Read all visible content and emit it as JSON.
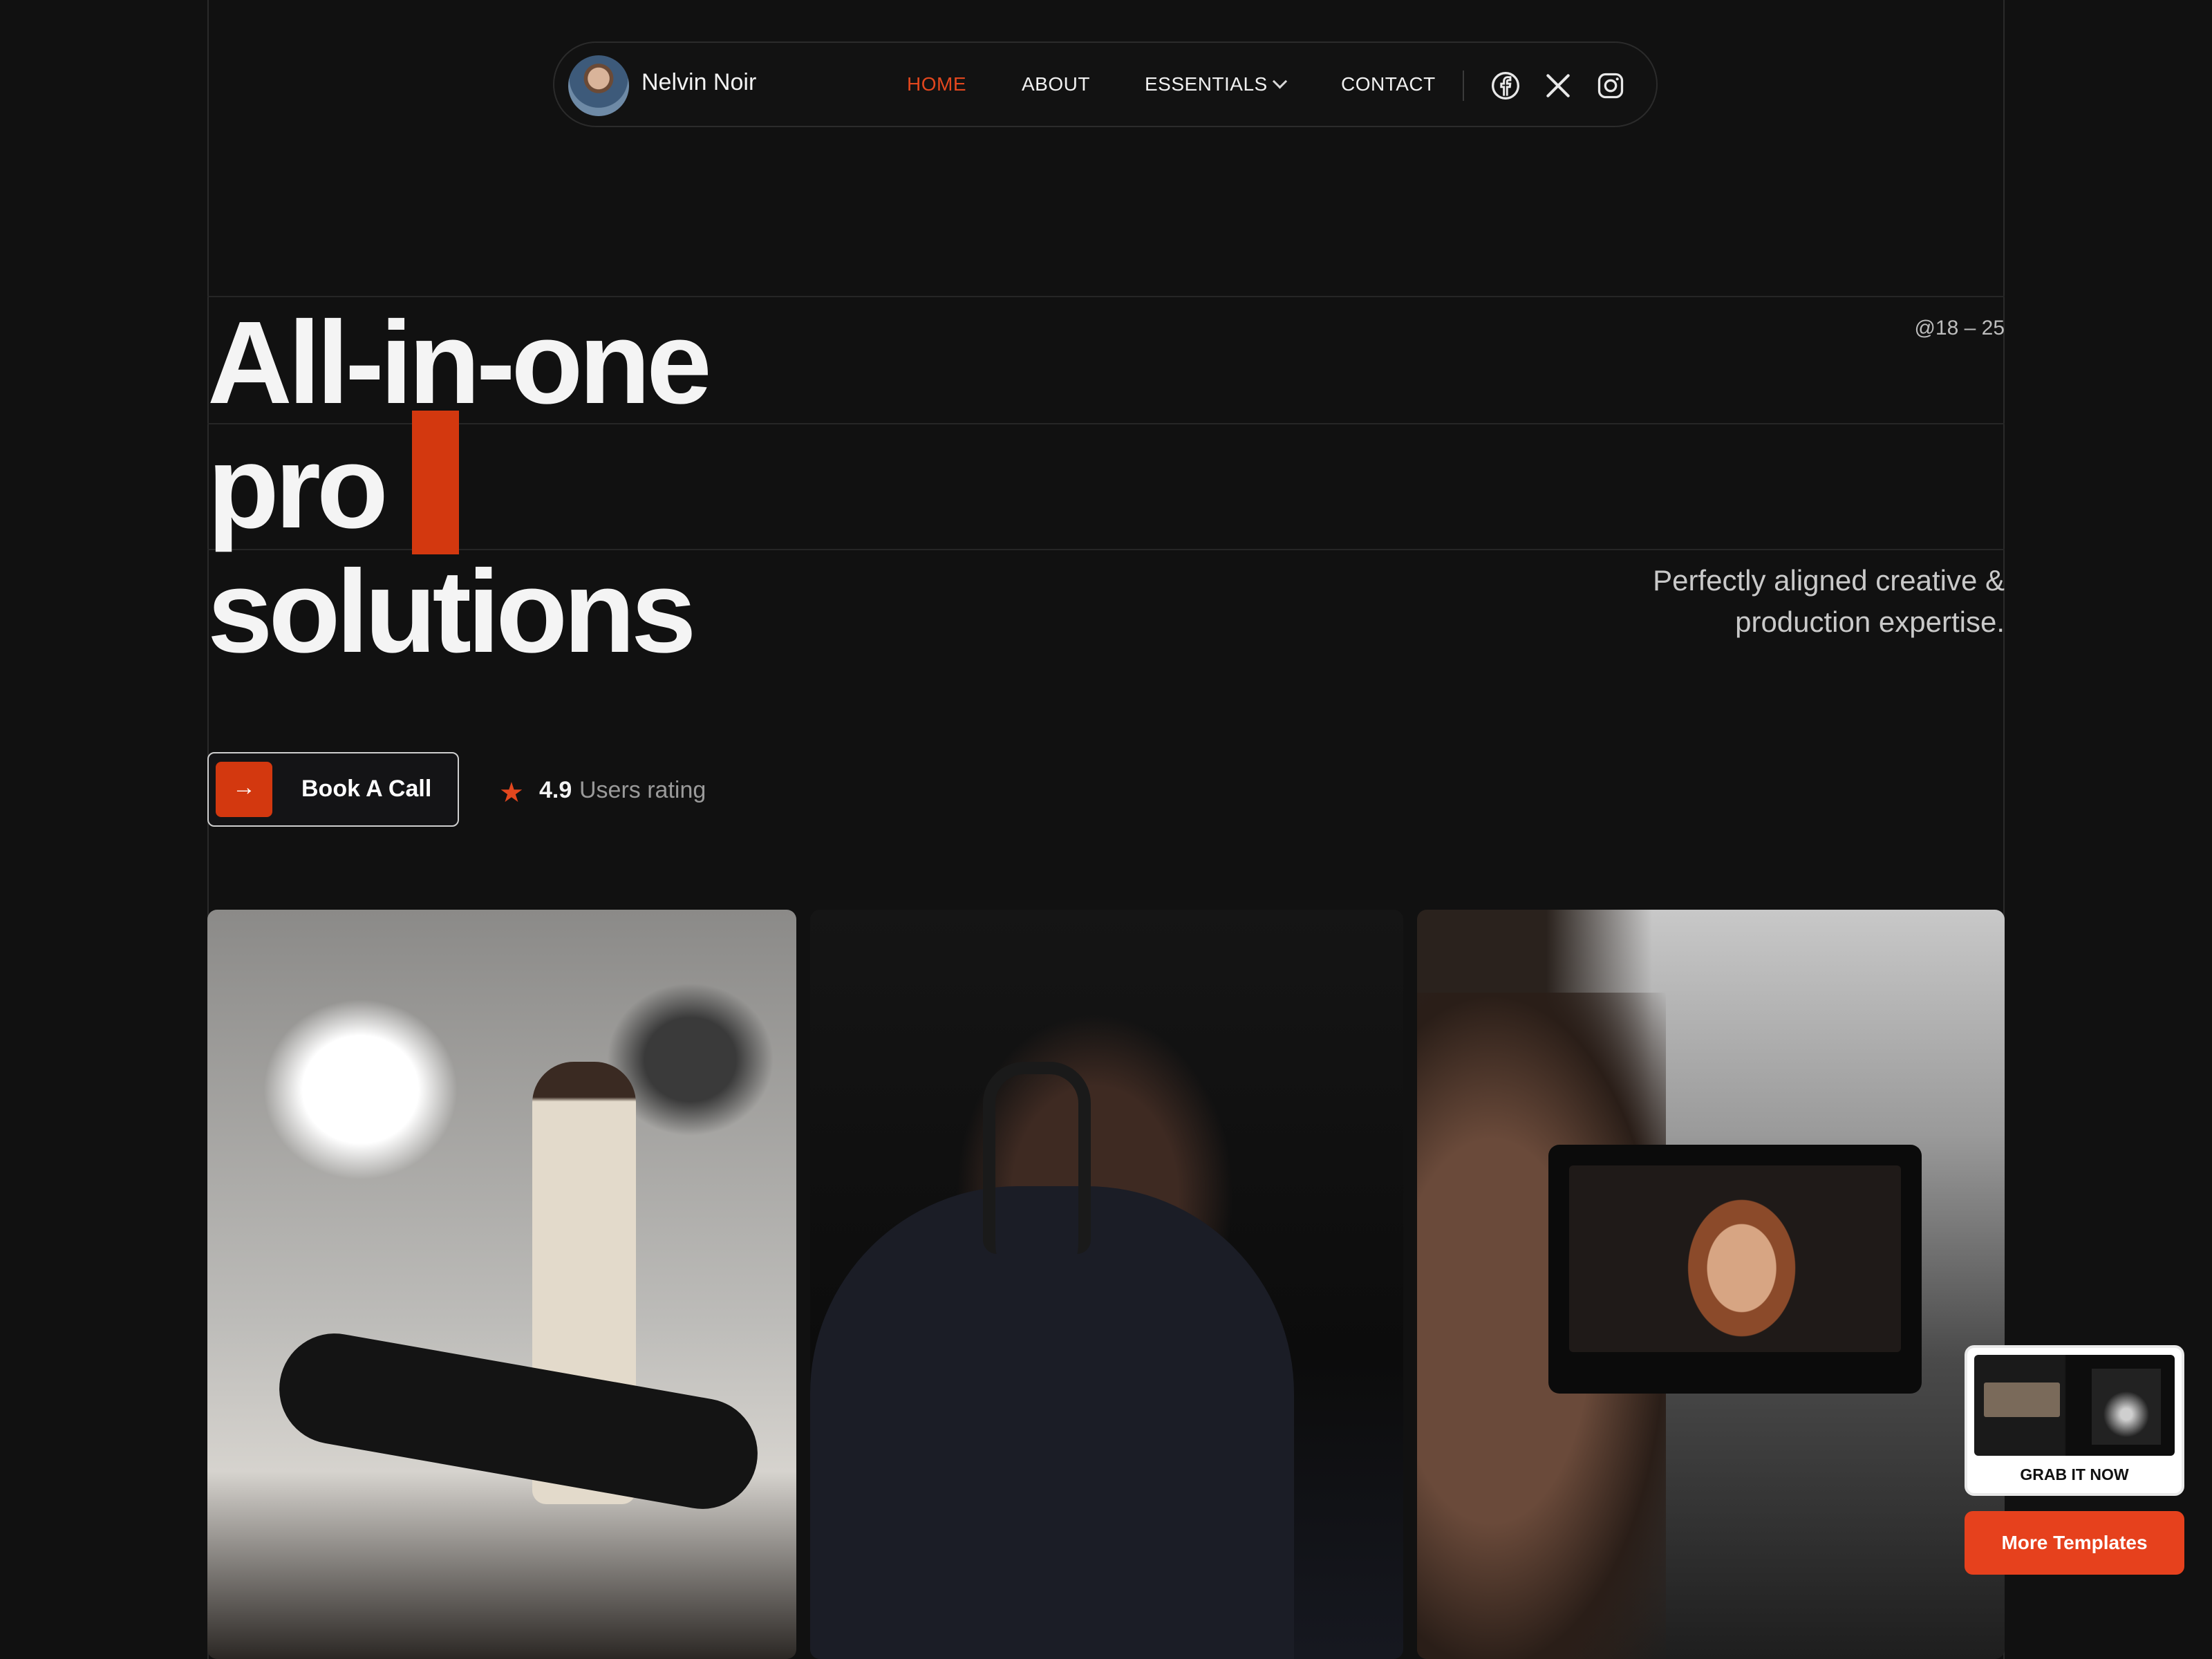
{
  "header": {
    "brand_name": "Nelvin Noir",
    "nav": [
      {
        "label": "HOME",
        "active": true
      },
      {
        "label": "ABOUT",
        "active": false
      },
      {
        "label": "ESSENTIALS",
        "active": false,
        "has_dropdown": true
      },
      {
        "label": "CONTACT",
        "active": false
      }
    ],
    "social_icons": [
      "facebook-icon",
      "x-icon",
      "instagram-icon"
    ]
  },
  "hero": {
    "line1": "All-in-one",
    "line2": "pro",
    "line3": "solutions",
    "tag": "@18 – 25",
    "subtext": "Perfectly aligned creative & production expertise."
  },
  "cta": {
    "button_label": "Book A Call",
    "arrow_icon": "arrow-right-icon",
    "rating_value": "4.9",
    "rating_text": "Users rating"
  },
  "floating": {
    "grab_label": "GRAB IT NOW",
    "more_label": "More Templates"
  },
  "colors": {
    "background": "#111111",
    "accent": "#e2471e",
    "accent_button": "#e6411d",
    "text": "#f4f4f4"
  }
}
